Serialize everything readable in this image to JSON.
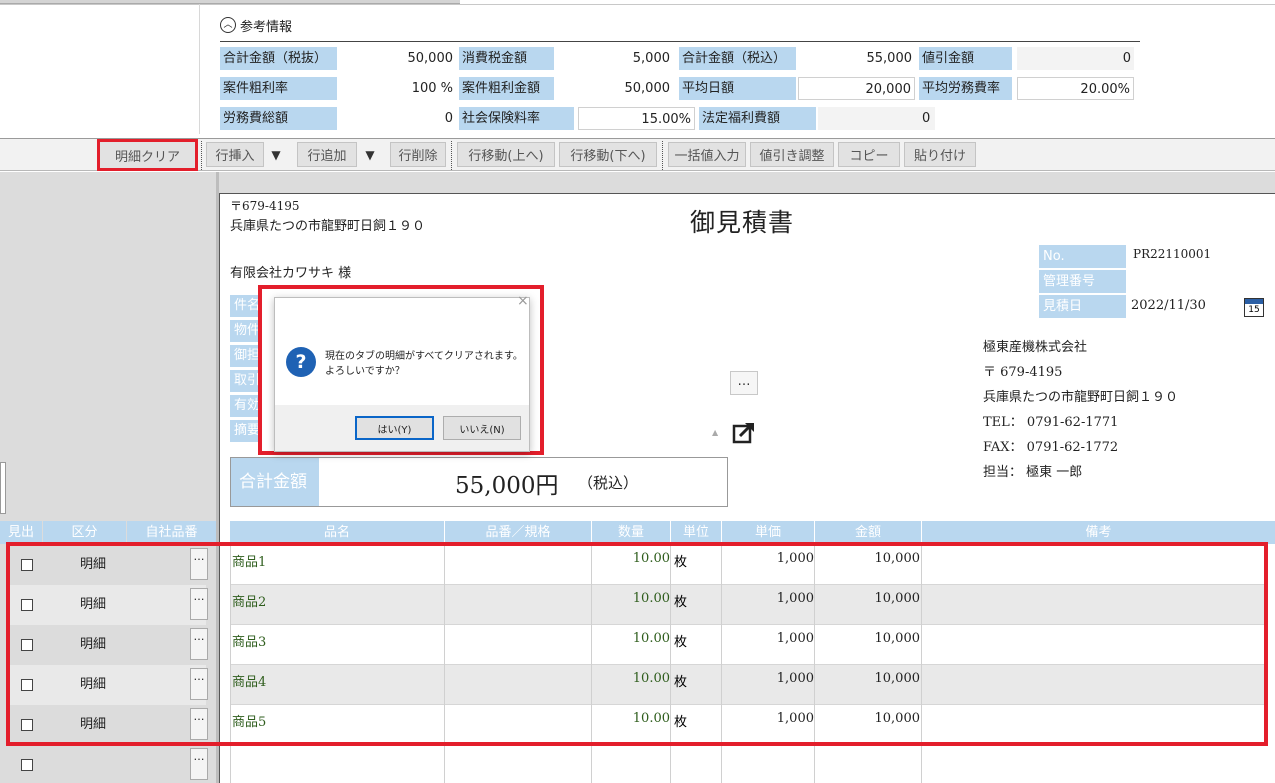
{
  "reference": {
    "toggle_icon": "chevron-up-circle-icon",
    "title": "参考情報",
    "row1": [
      {
        "label": "合計金額（税抜）",
        "value": "50,000"
      },
      {
        "label": "消費税金額",
        "value": "5,000"
      },
      {
        "label": "合計金額（税込）",
        "value": "55,000"
      },
      {
        "label": "値引金額",
        "value": "0"
      }
    ],
    "row2": [
      {
        "label": "案件粗利率",
        "value": "100 %"
      },
      {
        "label": "案件粗利金額",
        "value": "50,000"
      },
      {
        "label": "平均日額",
        "value": "20,000"
      },
      {
        "label": "平均労務費率",
        "value": "20.00%"
      }
    ],
    "row3": [
      {
        "label": "労務費総額",
        "value": "0"
      },
      {
        "label": "社会保険料率",
        "value": "15.00%"
      },
      {
        "label": "法定福利費額",
        "value": "0"
      }
    ]
  },
  "toolbar": {
    "clear": "明細クリア",
    "insert_row": "行挿入",
    "add_row": "行追加",
    "delete_row": "行削除",
    "move_up": "行移動(上へ)",
    "move_down": "行移動(下へ)",
    "bulk_input": "一括値入力",
    "discount": "値引き調整",
    "copy": "コピー",
    "paste": "貼り付け",
    "dropdown_glyph": "▼"
  },
  "document": {
    "postal": "〒679-4195",
    "address": "兵庫県たつの市龍野町日飼１９０",
    "title": "御見積書",
    "customer": "有限会社カワサキ 様",
    "field_labels": [
      "件名",
      "物件",
      "御担",
      "取引",
      "有効",
      "摘要"
    ],
    "meta": {
      "no_label": "No.",
      "no_value": "PR22110001",
      "mgmt_label": "管理番号",
      "date_label": "見積日",
      "date_value": "2022/11/30",
      "calendar_day": "15"
    },
    "company": {
      "name": "極東産機株式会社",
      "postal": "〒 679-4195",
      "address": "兵庫県たつの市龍野町日飼１９０",
      "tel": "TEL： 0791-62-1771",
      "fax": "FAX： 0791-62-1772",
      "person": "担当： 極東 一郎"
    },
    "ellipsis": "…",
    "total_label": "合計金額",
    "total_value": "55,000円",
    "total_tax": "（税込）"
  },
  "left_table": {
    "headers": [
      "見出",
      "区分",
      "自社品番"
    ],
    "rows": [
      "明細",
      "明細",
      "明細",
      "明細",
      "明細"
    ],
    "dots": "…"
  },
  "items_table": {
    "headers": [
      "品名",
      "品番／規格",
      "数量",
      "単位",
      "単価",
      "金額",
      "備考"
    ],
    "rows": [
      {
        "name": "商品1",
        "qty": "10.00",
        "unit": "枚",
        "price": "1,000",
        "amount": "10,000"
      },
      {
        "name": "商品2",
        "qty": "10.00",
        "unit": "枚",
        "price": "1,000",
        "amount": "10,000"
      },
      {
        "name": "商品3",
        "qty": "10.00",
        "unit": "枚",
        "price": "1,000",
        "amount": "10,000"
      },
      {
        "name": "商品4",
        "qty": "10.00",
        "unit": "枚",
        "price": "1,000",
        "amount": "10,000"
      },
      {
        "name": "商品5",
        "qty": "10.00",
        "unit": "枚",
        "price": "1,000",
        "amount": "10,000"
      }
    ]
  },
  "dialog": {
    "icon": "question-icon",
    "close": "×",
    "message_line1": "現在のタブの明細がすべてクリアされます。",
    "message_line2": "よろしいですか？",
    "yes": "はい(Y)",
    "no": "いいえ(N)"
  },
  "colors": {
    "label_blue": "#b9d7ef",
    "highlight_red": "#e31e2b",
    "value_green": "#2e5d1c",
    "dialog_icon_blue": "#1f62b4"
  }
}
